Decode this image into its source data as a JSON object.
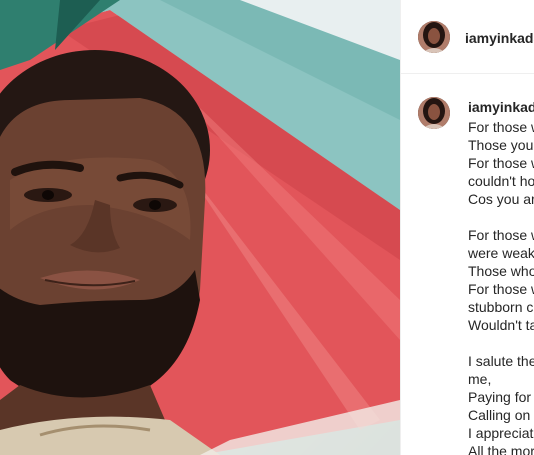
{
  "post": {
    "username": "iamyinkada",
    "caption_username": "iamyinkada",
    "caption_lines": [
      "For those w",
      "Those you",
      "For those w",
      "couldn't ho",
      "Cos you are",
      "",
      "For those w",
      "were weak,",
      "Those who",
      "For those w",
      "stubborn c",
      "Wouldn't ta",
      "",
      "I salute the",
      "me,",
      "Paying for",
      "Calling on",
      "I appreciat",
      "All the mor"
    ]
  }
}
